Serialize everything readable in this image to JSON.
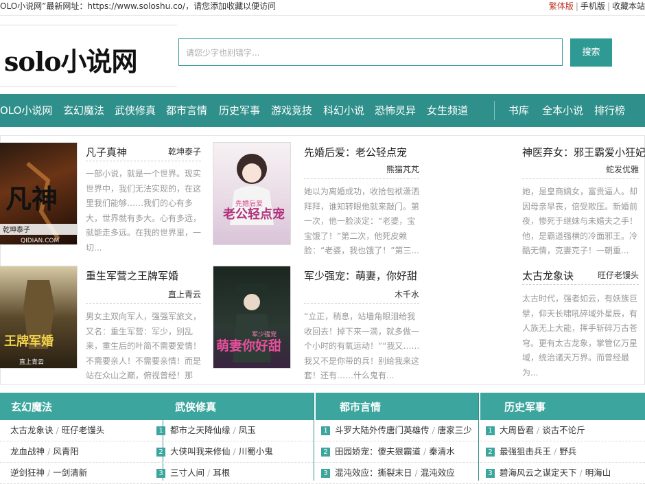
{
  "topbar": {
    "notice": "OLO小说网”最新网址：https://www.soloshu.co/，请您添加收藏以便访问",
    "traditional": "繁体版",
    "mobile": "手机版",
    "bookmark": "收藏本站",
    "sep": "|"
  },
  "header": {
    "logo": "solo小说网",
    "search_placeholder": "请您少字也别错字...",
    "search_button": "搜索"
  },
  "nav": {
    "items": [
      "OLO小说网",
      "玄幻魔法",
      "武侠修真",
      "都市言情",
      "历史军事",
      "游戏竞技",
      "科幻小说",
      "恐怖灵异",
      "女生频道"
    ],
    "right": [
      "书库",
      "全本小说",
      "排行榜"
    ]
  },
  "featured": [
    {
      "title": "凡子真神",
      "author": "乾坤泰子",
      "desc": "一部小说，就是一个世界。现实世界中，我们无法实现的，在这里我们能够……我们的心有多大，世界就有多大。心有多远，就能走多远。在我的世界里，一切..."
    },
    {
      "title": "先婚后爱：老公轻点宠",
      "author": "熊猫芃芃",
      "desc": "她以为离婚成功，收拾包袱潇洒拜拜，谁知转眼他就来敲门。第一次，他一脸淡定：“老婆，宝宝饿了！”第二次，他死皮赖脸：“老婆，我也饿了！”第三..."
    },
    {
      "title": "神医弃女：邪王霸爱小狂妃",
      "author": "蛇发优雅",
      "desc": "她，是皇商嫡女，富贵逼人。却因母亲早丧，倍受欺压。新婚前夜，惨死于继妹与未婚夫之手！他，是霸道强横的冷面邪王。冷酷无情，克妻克子！一朝重..."
    },
    {
      "title": "重生军营之王牌军婚",
      "author": "直上青云",
      "desc": "男女主双向军人，强强军旅文，又名：重生军营：军少，别乱来，重生后的叶简不需要爱情！不需要亲人！不需要亲情！而是站在众山之巅，俯视曾经！那些..."
    },
    {
      "title": "军少强宠：萌妻，你好甜",
      "author": "木千水",
      "desc": "“立正，稍息，站墙角眼泪给我收回去！掉下来一滴，就多做一个小时的有氧运动！”“我又……我又不是你带的兵！别给我来这套！还有……什么鬼有..."
    },
    {
      "title": "太古龙象诀",
      "author": "旺仔老馒头",
      "desc": "太古时代，强者如云，有妖族巨擘，仰天长啸吼碎域外星辰，有人族无上大能，挥手斩碎万古苍穹。更有太古龙象，掌管亿万星域，统治诸天万界。而曾经最为..."
    }
  ],
  "covers": {
    "c1": "乾坤泰子",
    "c1_site": "QIDIAN.COM",
    "c1_big": "凡神",
    "c2_big": "老公轻点宠",
    "c2_small": "先婚后爱",
    "c4_big": "王牌军婚",
    "c4_small": "直上青云",
    "c5_big": "萌妻你好甜",
    "c5_small": "军少强宠"
  },
  "lists": [
    {
      "head": "玄幻魔法",
      "rows": [
        {
          "book": "太古龙象诀",
          "author": "旺仔老馒头",
          "num": ""
        },
        {
          "book": "龙血战神",
          "author": "风青阳",
          "num": ""
        },
        {
          "book": "逆剑狂神",
          "author": "一剑清新",
          "num": ""
        }
      ]
    },
    {
      "head": "武侠修真",
      "rows": [
        {
          "book": "都市之天降仙缘",
          "author": "凤玉",
          "num": "1"
        },
        {
          "book": "大侠叫我来修仙",
          "author": "川蜀小鬼",
          "num": "2"
        },
        {
          "book": "三寸人间",
          "author": "耳根",
          "num": "3"
        }
      ]
    },
    {
      "head": "都市言情",
      "rows": [
        {
          "book": "斗罗大陆外传唐门英雄传",
          "author": "唐家三少",
          "num": "1"
        },
        {
          "book": "田园娇宠：傻夫狠霸道",
          "author": "秦清水",
          "num": "2"
        },
        {
          "book": "混沌效应：撕裂末日",
          "author": "混沌效应",
          "num": "3"
        }
      ]
    },
    {
      "head": "历史军事",
      "rows": [
        {
          "book": "大周昏君",
          "author": "谈古不论斤",
          "num": "1"
        },
        {
          "book": "最强狙击兵王",
          "author": "野兵",
          "num": "2"
        },
        {
          "book": "碧海风云之谋定天下",
          "author": "明海山",
          "num": "3"
        }
      ]
    }
  ],
  "colors": {
    "accent": "#2f8f8a",
    "accent_light": "#3ca59e",
    "red": "#c0392b"
  }
}
